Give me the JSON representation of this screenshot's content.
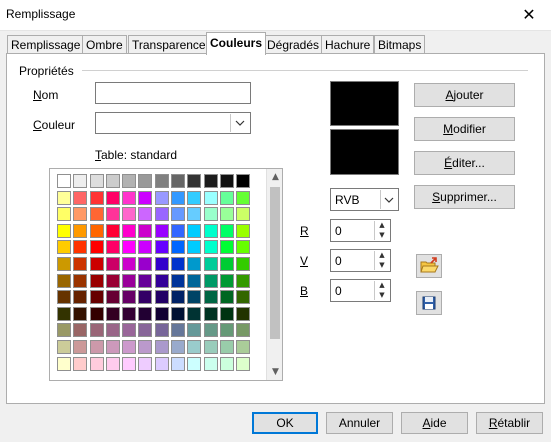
{
  "window": {
    "title": "Remplissage",
    "close_glyph": "✕"
  },
  "tabs": [
    {
      "label": "Remplissage"
    },
    {
      "label": "Ombre"
    },
    {
      "label": "Transparence"
    },
    {
      "label": "Couleurs",
      "active": true
    },
    {
      "label": "Dégradés"
    },
    {
      "label": "Hachure"
    },
    {
      "label": "Bitmaps"
    }
  ],
  "properties": {
    "group_label": "Propriétés",
    "name_label_mnemonic": "N",
    "name_label_rest": "om",
    "name_value": "",
    "color_label_mnemonic": "C",
    "color_label_rest": "ouleur",
    "color_value": "",
    "table_label_mnemonic": "T",
    "table_label_rest": "able: standard"
  },
  "color_model": {
    "selected": "RVB",
    "channels": [
      {
        "mnemonic": "R",
        "value": "0"
      },
      {
        "mnemonic": "V",
        "value": "0"
      },
      {
        "mnemonic": "B",
        "value": "0"
      }
    ]
  },
  "actions": {
    "add_mnemonic": "A",
    "add_rest": "jouter",
    "modify_mnemonic": "M",
    "modify_rest": "odifier",
    "edit_mnemonic": "É",
    "edit_rest": "diter...",
    "delete_mnemonic": "S",
    "delete_rest": "upprimer..."
  },
  "icons": {
    "open": "open-folder-icon",
    "save": "save-disk-icon"
  },
  "footer": {
    "ok": "OK",
    "cancel": "Annuler",
    "help_mnemonic": "A",
    "help_rest": "ide",
    "reset_mnemonic": "R",
    "reset_rest": "établir"
  },
  "palette_colors": [
    [
      "#ffffff",
      "#eeeeee",
      "#dddddd",
      "#cccccc",
      "#b2b2b2",
      "#999999",
      "#808080",
      "#666666",
      "#333333",
      "#1c1c1c",
      "#111111",
      "#000000"
    ],
    [
      "#ffff99",
      "#ff6666",
      "#ff3333",
      "#ff0066",
      "#ff33cc",
      "#cc00ff",
      "#9999ff",
      "#3399ff",
      "#33ccff",
      "#99ffff",
      "#66ff99",
      "#66ff33"
    ],
    [
      "#ffff66",
      "#ff9966",
      "#ff6633",
      "#ff3399",
      "#ff66cc",
      "#cc66ff",
      "#9966ff",
      "#6699ff",
      "#66ccff",
      "#99ffcc",
      "#99ff99",
      "#ccff66"
    ],
    [
      "#ffff00",
      "#ff9900",
      "#ff6600",
      "#ff0033",
      "#ff00cc",
      "#cc00cc",
      "#9900ff",
      "#3366ff",
      "#00ccff",
      "#00ffcc",
      "#00ff66",
      "#99ff00"
    ],
    [
      "#ffcc00",
      "#ff3300",
      "#ff0000",
      "#ff0066",
      "#ff00ff",
      "#cc00ff",
      "#6600ff",
      "#0066ff",
      "#00ccff",
      "#00ffcc",
      "#00ff33",
      "#66ff00"
    ],
    [
      "#cc9900",
      "#cc3300",
      "#cc0000",
      "#cc0066",
      "#cc00cc",
      "#9900cc",
      "#3300cc",
      "#0033cc",
      "#0099cc",
      "#00cc99",
      "#00cc33",
      "#33cc00"
    ],
    [
      "#996600",
      "#993300",
      "#990000",
      "#990033",
      "#990099",
      "#660099",
      "#330099",
      "#003399",
      "#006699",
      "#009966",
      "#009933",
      "#339900"
    ],
    [
      "#663300",
      "#662200",
      "#660000",
      "#660033",
      "#660066",
      "#330066",
      "#220066",
      "#002266",
      "#004466",
      "#006644",
      "#006622",
      "#336600"
    ],
    [
      "#333300",
      "#331100",
      "#330000",
      "#330022",
      "#330033",
      "#220033",
      "#110033",
      "#001133",
      "#003333",
      "#003322",
      "#003311",
      "#223300"
    ],
    [
      "#999966",
      "#996666",
      "#996677",
      "#996688",
      "#996699",
      "#886699",
      "#776699",
      "#667799",
      "#669999",
      "#669988",
      "#669977",
      "#779966"
    ],
    [
      "#cccc99",
      "#cc9999",
      "#cc99aa",
      "#cc99bb",
      "#cc99cc",
      "#bb99cc",
      "#aa99cc",
      "#99aacc",
      "#99cccc",
      "#99ccbb",
      "#99ccaa",
      "#aacc99"
    ],
    [
      "#ffffcc",
      "#ffcccc",
      "#ffccdd",
      "#ffccee",
      "#ffccff",
      "#eeccff",
      "#ddccff",
      "#ccddff",
      "#ccffff",
      "#ccffee",
      "#ccffdd",
      "#ddffcc"
    ]
  ]
}
